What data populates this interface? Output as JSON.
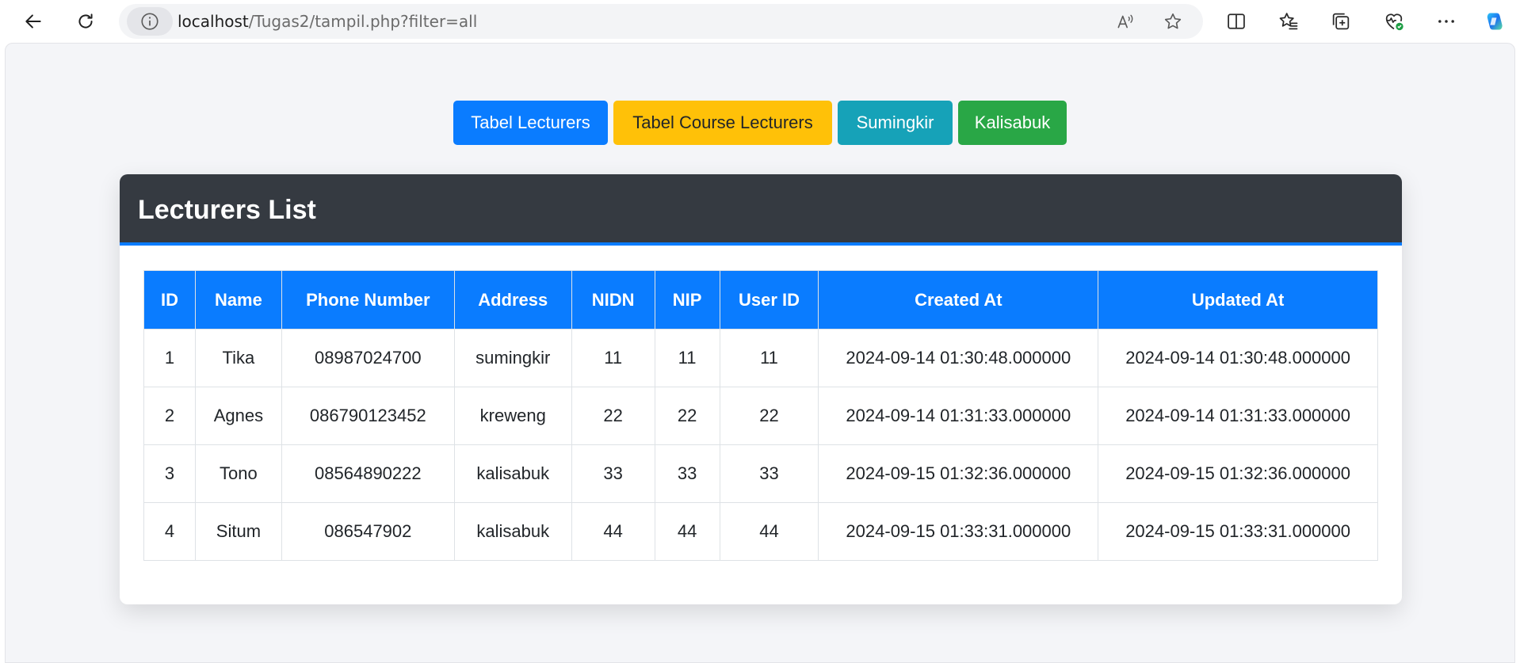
{
  "browser": {
    "url_host": "localhost",
    "url_path": "/Tugas2/tampil.php?filter=all"
  },
  "nav_buttons": [
    {
      "label": "Tabel Lecturers",
      "color": "#0a7cff"
    },
    {
      "label": "Tabel Course Lecturers",
      "color": "#ffc108"
    },
    {
      "label": "Sumingkir",
      "color": "#16a2b8"
    },
    {
      "label": "Kalisabuk",
      "color": "#29a746"
    }
  ],
  "card": {
    "title": "Lecturers List",
    "header_color": "#353a41",
    "accent_color": "#0a7cff"
  },
  "table": {
    "columns": [
      "ID",
      "Name",
      "Phone Number",
      "Address",
      "NIDN",
      "NIP",
      "User ID",
      "Created At",
      "Updated At"
    ],
    "rows": [
      [
        "1",
        "Tika",
        "08987024700",
        "sumingkir",
        "11",
        "11",
        "11",
        "2024-09-14 01:30:48.000000",
        "2024-09-14 01:30:48.000000"
      ],
      [
        "2",
        "Agnes",
        "086790123452",
        "kreweng",
        "22",
        "22",
        "22",
        "2024-09-14 01:31:33.000000",
        "2024-09-14 01:31:33.000000"
      ],
      [
        "3",
        "Tono",
        "08564890222",
        "kalisabuk",
        "33",
        "33",
        "33",
        "2024-09-15 01:32:36.000000",
        "2024-09-15 01:32:36.000000"
      ],
      [
        "4",
        "Situm",
        "086547902",
        "kalisabuk",
        "44",
        "44",
        "44",
        "2024-09-15 01:33:31.000000",
        "2024-09-15 01:33:31.000000"
      ]
    ]
  }
}
